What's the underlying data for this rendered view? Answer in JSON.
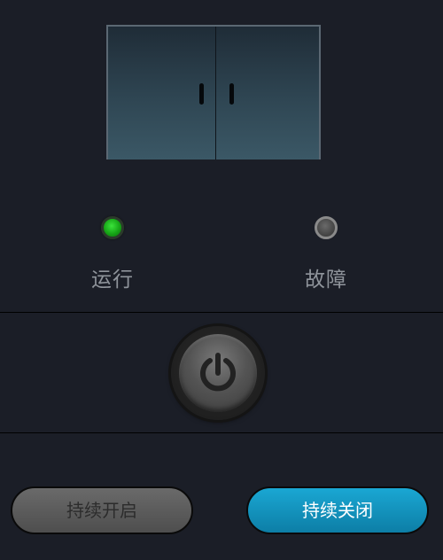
{
  "colors": {
    "background": "#1b1e27",
    "run_lamp": "#16a516",
    "fault_lamp": "#474747",
    "label_text": "#8f949b",
    "close_button": "#1aa7d3",
    "open_button": "#5a5a5a"
  },
  "cabinet": {
    "icon": "cabinet-double-door-icon"
  },
  "indicators": {
    "run": {
      "label": "运行",
      "state": "on"
    },
    "fault": {
      "label": "故障",
      "state": "off"
    }
  },
  "power": {
    "icon": "power-icon"
  },
  "buttons": {
    "open_label": "持续开启",
    "close_label": "持续关闭"
  }
}
